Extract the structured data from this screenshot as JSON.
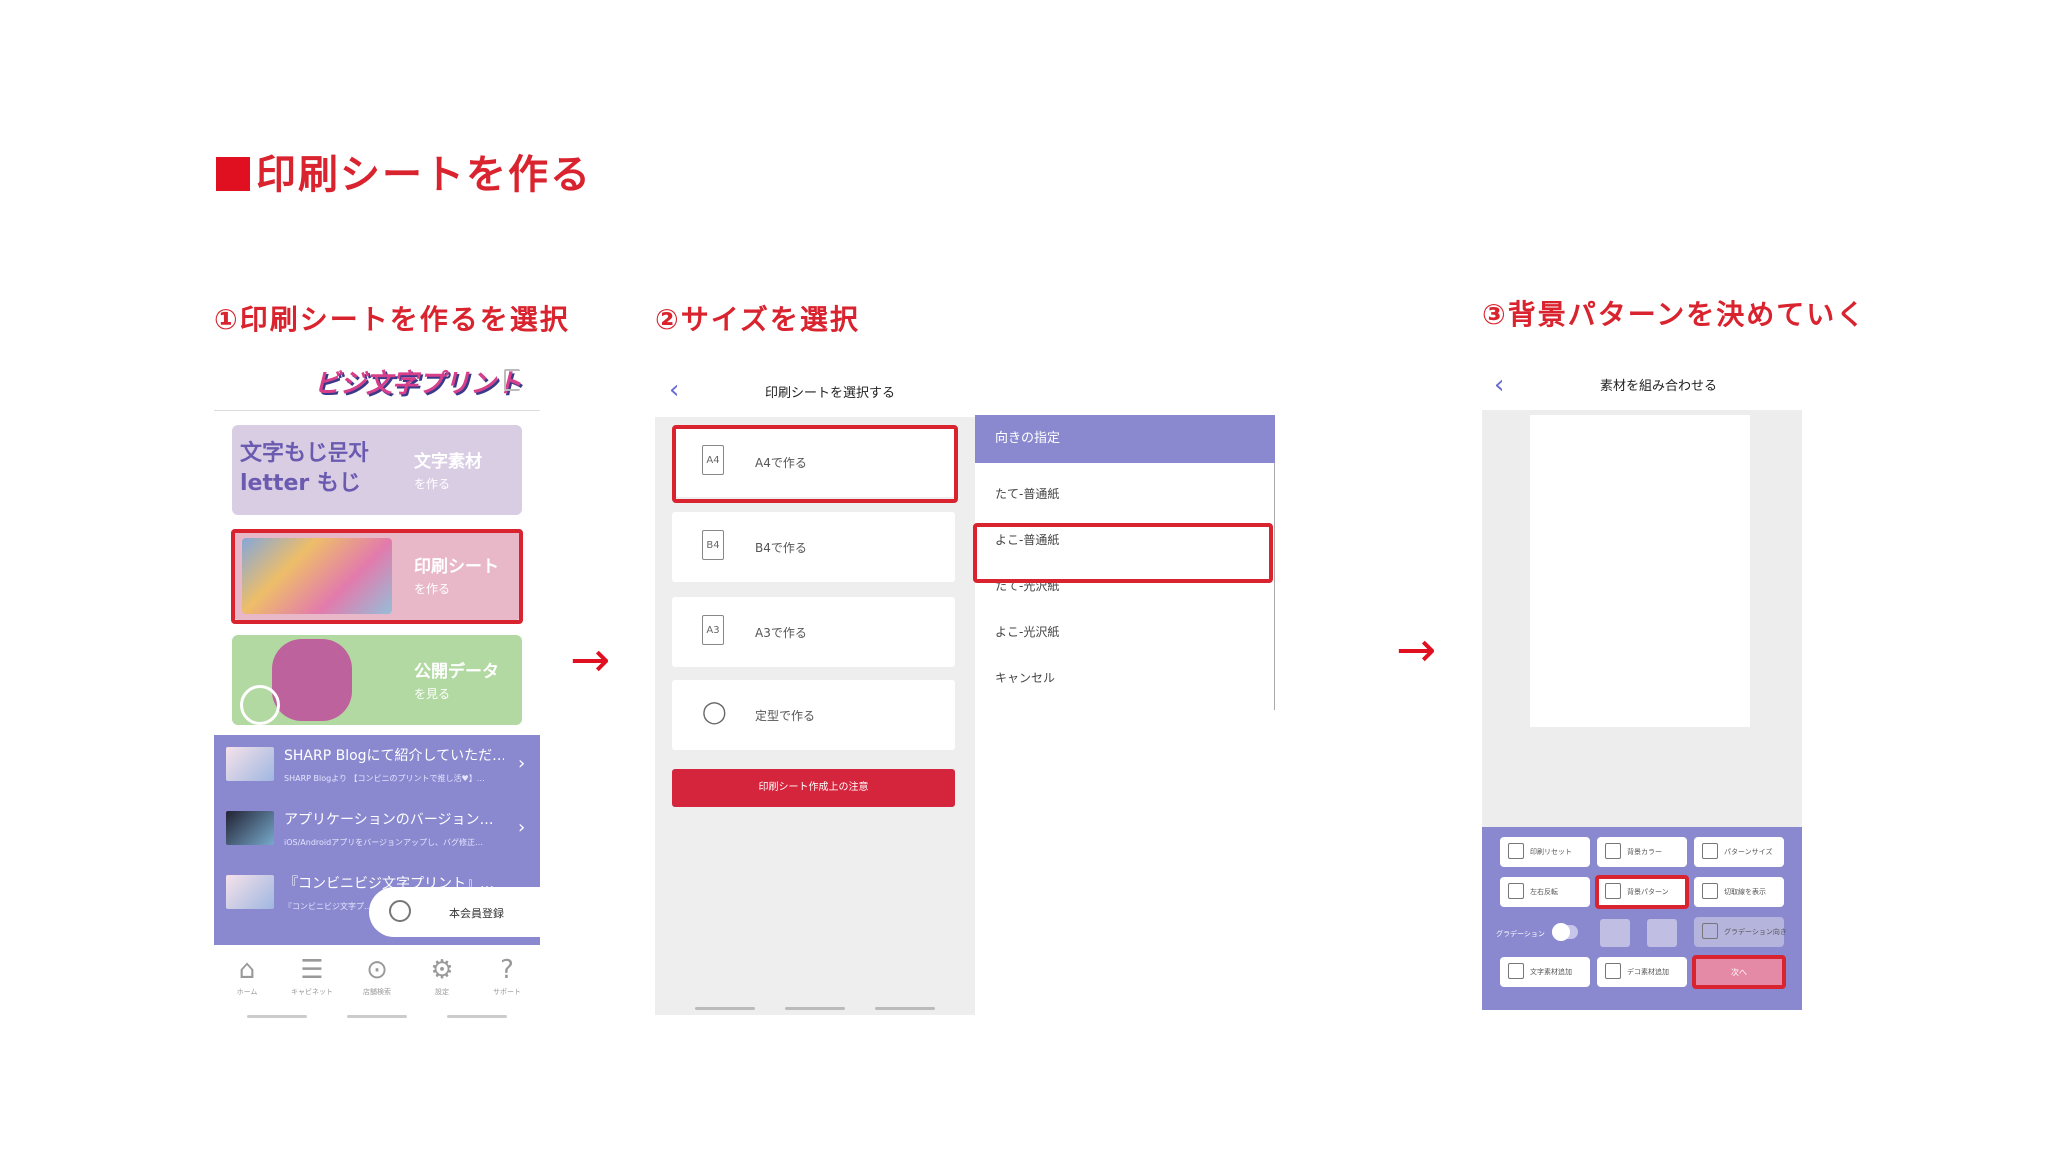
{
  "title": "印刷シートを作る",
  "steps": {
    "s1": "①印刷シートを作るを選択",
    "s2": "②サイズを選択",
    "s3": "③背景パターンを決めていく"
  },
  "arrows": [
    "→",
    "→"
  ],
  "panel1": {
    "logo": "ビジ文字プリント",
    "cards": [
      {
        "title": "文字素材",
        "sub": "を作る",
        "deco": "文字もじ문자 letter もじ"
      },
      {
        "title": "印刷シート",
        "sub": "を作る"
      },
      {
        "title": "公開データ",
        "sub": "を見る"
      }
    ],
    "news": [
      {
        "title": "SHARP Blogにて紹介していただ…",
        "sub": "SHARP Blogより 【コンビニのプリントで推し活♥】…"
      },
      {
        "title": "アプリケーションのバージョン…",
        "sub": "iOS/Androidアプリをバージョンアップし、バグ修正…"
      },
      {
        "title": "『コンビニビジ文字プリント』…",
        "sub": "『コンビニビジ文字プ…"
      }
    ],
    "chevron": "›",
    "member_label": "本会員登録",
    "tabs": [
      {
        "icon": "⌂",
        "label": "ホーム"
      },
      {
        "icon": "☰",
        "label": "キャビネット"
      },
      {
        "icon": "⊙",
        "label": "店舗検索"
      },
      {
        "icon": "⚙",
        "label": "設定"
      },
      {
        "icon": "?",
        "label": "サポート"
      }
    ]
  },
  "panel2": {
    "back": "‹",
    "nav_title": "印刷シートを選択する",
    "sizes": [
      {
        "icon": "A4",
        "label": "A4で作る"
      },
      {
        "icon": "B4",
        "label": "B4で作る"
      },
      {
        "icon": "A3",
        "label": "A3で作る"
      },
      {
        "icon": "◯",
        "label": "定型で作る"
      }
    ],
    "warning_button": "印刷シート作成上の注意",
    "sheet_title": "向きの指定",
    "options": [
      "たて-普通紙",
      "よこ-普通紙",
      "たて-光沢紙",
      "よこ-光沢紙",
      "キャンセル"
    ]
  },
  "panel3": {
    "back": "‹",
    "nav_title": "素材を組み合わせる",
    "tools": {
      "print_reset": "印刷リセット",
      "bg_color": "背景カラー",
      "pattern_size": "パターンサイズ",
      "mirror": "左右反転",
      "bg_pattern": "背景パターン",
      "cut_line": "切取線を表示",
      "gradation": "グラデーション",
      "grad_direction": "グラデーション向き",
      "add_text": "文字素材追加",
      "add_deco": "デコ素材追加",
      "next": "次へ"
    }
  },
  "colors": {
    "accent": "#d9232e",
    "purple": "#8a89cf",
    "button_red": "#d4253d",
    "next_pink": "#e58aa6"
  }
}
